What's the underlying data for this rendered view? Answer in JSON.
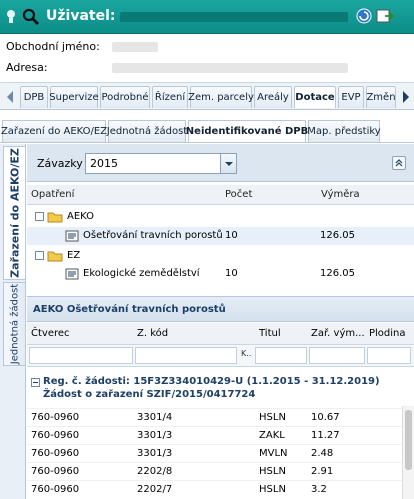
{
  "titlebar": {
    "title": "Uživatel:",
    "bulb_icon": "lightbulb-icon",
    "search_icon": "magnifier-icon",
    "refresh_icon": "refresh-icon",
    "export_icon": "export-icon"
  },
  "info": {
    "business_name_label": "Obchodní jméno:",
    "address_label": "Adresa:"
  },
  "tabs": [
    "DPB",
    "Supervize",
    "Podrobné",
    "Řízení",
    "Zem. parcely",
    "Areály",
    "Dotace",
    "EVP",
    "Změn"
  ],
  "active_tab": "Dotace",
  "subtabs": [
    "Zařazení do AEKO/EZ",
    "Jednotná žádost",
    "Neidentifikované DPB",
    "Map. předstiky"
  ],
  "active_subtab": "Neidentifikované DPB",
  "vertical_tabs": [
    "Zařazení do AEKO/EZ",
    "Jednotná žádost"
  ],
  "filter": {
    "label": "Závazky k",
    "year": "2015"
  },
  "tree": {
    "headers": [
      "Opatření",
      "Počet",
      "Výměra"
    ],
    "nodes": [
      {
        "label": "AEKO"
      },
      {
        "label": "Ošetřování travních porostů",
        "count": "10",
        "area": "126.05"
      },
      {
        "label": "EZ"
      },
      {
        "label": "Ekologické zemědělství",
        "count": "10",
        "area": "126.05"
      }
    ]
  },
  "detail": {
    "title": "AEKO Ošetřování travních porostů",
    "columns": [
      "Čtverec",
      "Z. kód",
      "Titul",
      "Zař. vým...",
      "Plodina"
    ],
    "filter_tag": "K..",
    "group_line1": "Reg. č. žádosti: 15F3Z334010429-U (1.1.2015 - 31.12.2019)",
    "group_line2": "Žádost o zařazení SZIF/2015/0417724",
    "rows": [
      {
        "ctverec": "760-0960",
        "zkod": "3301/4",
        "titul": "HSLN",
        "vym": "10.67"
      },
      {
        "ctverec": "760-0960",
        "zkod": "3301/3",
        "titul": "ZAKL",
        "vym": "11.27"
      },
      {
        "ctverec": "760-0960",
        "zkod": "3301/3",
        "titul": "MVLN",
        "vym": "2.48"
      },
      {
        "ctverec": "760-0960",
        "zkod": "2202/8",
        "titul": "HSLN",
        "vym": "2.91"
      },
      {
        "ctverec": "760-0960",
        "zkod": "2202/7",
        "titul": "HSLN",
        "vym": "3.2"
      }
    ]
  },
  "colors": {
    "titlebar": "#129a95",
    "accent": "#1d3f66",
    "panel": "#dbe6f1"
  }
}
